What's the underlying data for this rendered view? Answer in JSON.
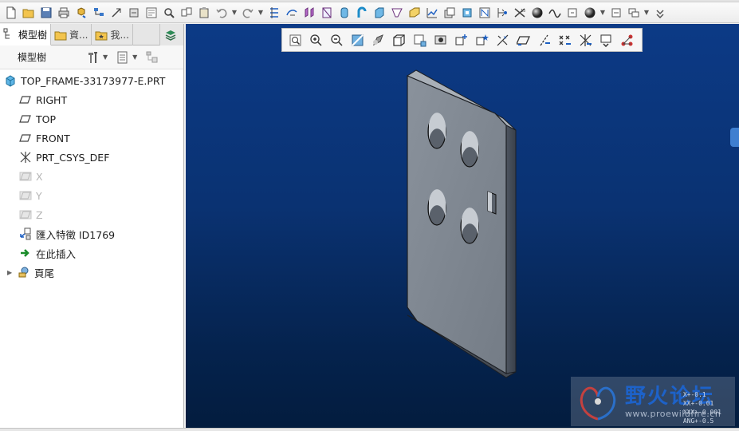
{
  "main_toolbar": {
    "icons": [
      "new-file-icon",
      "open-folder-icon",
      "save-icon",
      "print-icon",
      "regenerate-icon",
      "model-tree-icon",
      "measure-icon",
      "repaint-icon",
      "zoom-fit-icon",
      "copy-icon",
      "mirror-icon",
      "undo-icon",
      "redo-icon",
      "datum-points-icon",
      "sketch-icon",
      "extrude-icon",
      "plane-icon",
      "revolve-icon",
      "sweep-icon",
      "blend-icon",
      "draft-icon",
      "round-icon",
      "chamfer-icon",
      "analysis-icon",
      "display-style-icon",
      "shell-icon",
      "hole-icon",
      "pattern-icon",
      "csys-icon",
      "sphere-icon",
      "curve-icon",
      "insert-icon",
      "appearance-icon",
      "view-manager-icon",
      "settings-icon"
    ]
  },
  "navigator": {
    "tabs": [
      {
        "label": "模型樹",
        "icon": "model-tree-tab-icon",
        "active": true
      },
      {
        "label": "資...",
        "icon": "folder-browser-icon",
        "active": false
      },
      {
        "label": "我...",
        "icon": "favorites-icon",
        "active": false
      }
    ],
    "header_title": "模型樹"
  },
  "model_tree": [
    {
      "label": "TOP_FRAME-33173977-E.PRT",
      "icon": "part-icon",
      "level": 0,
      "dim": false
    },
    {
      "label": "RIGHT",
      "icon": "datum-plane-icon",
      "level": 1,
      "dim": false
    },
    {
      "label": "TOP",
      "icon": "datum-plane-icon",
      "level": 1,
      "dim": false
    },
    {
      "label": "FRONT",
      "icon": "datum-plane-icon",
      "level": 1,
      "dim": false
    },
    {
      "label": "PRT_CSYS_DEF",
      "icon": "coordinate-system-icon",
      "level": 1,
      "dim": false
    },
    {
      "label": "X",
      "icon": "datum-plane-icon",
      "level": 1,
      "dim": true
    },
    {
      "label": "Y",
      "icon": "datum-plane-icon",
      "level": 1,
      "dim": true
    },
    {
      "label": "Z",
      "icon": "datum-plane-icon",
      "level": 1,
      "dim": true
    },
    {
      "label": "匯入特徵 ID1769",
      "icon": "import-feature-icon",
      "level": 1,
      "dim": false
    },
    {
      "label": "在此插入",
      "icon": "insert-here-arrow-icon",
      "level": 1,
      "dim": false
    },
    {
      "label": "頁尾",
      "icon": "footer-icon",
      "level": 0,
      "dim": false,
      "expandable": true
    }
  ],
  "view_toolbar": {
    "icons": [
      "refit-icon",
      "zoom-in-icon",
      "zoom-out-icon",
      "repaint-view-icon",
      "shading-icon",
      "saved-views-icon",
      "view-manager-icon",
      "perspective-icon",
      "spin-center-icon",
      "annotation-display-icon",
      "plane-display-icon",
      "axis-display-icon",
      "point-display-icon",
      "csys-display-icon",
      "model-display-icon",
      "connector-icon"
    ]
  },
  "watermark": {
    "title": "野火论坛",
    "url": "www.proewildfire.cn"
  },
  "tolerance": [
    "X+-0.1",
    "XX+-0.01",
    "XXX+-0.001",
    "ANG+-0.5"
  ],
  "colors": {
    "viewport_top": "#0c3a86",
    "viewport_bottom": "#031c3e",
    "part_face": "#7b848f",
    "part_edge": "#1c1f24",
    "accent": "#3f7fd0"
  }
}
